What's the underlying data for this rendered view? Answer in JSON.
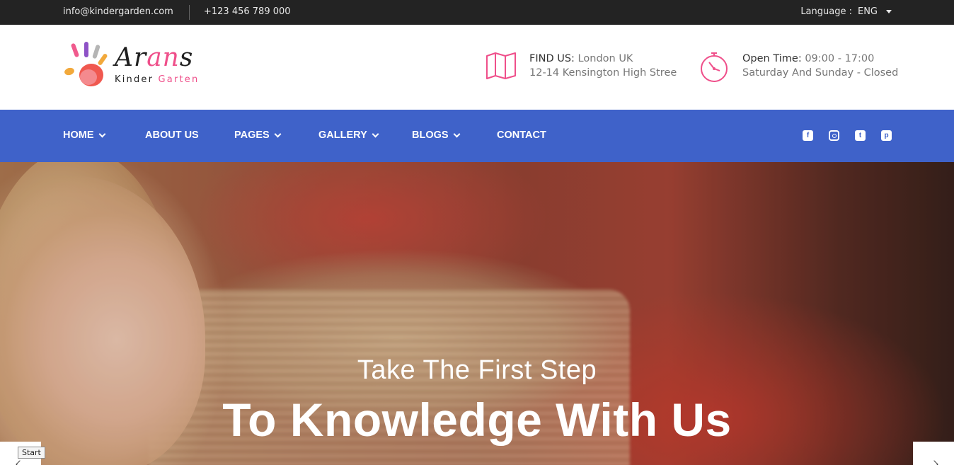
{
  "topbar": {
    "email": "info@kindergarden.com",
    "phone": "+123 456 789 000",
    "language_label": "Language :",
    "language_value": "ENG"
  },
  "logo": {
    "brand_part1": "Ar",
    "brand_part2": "an",
    "brand_part3": "s",
    "sub_part1": "Kinder",
    "sub_part2": "Garten"
  },
  "contact": {
    "find_label": "FIND US:",
    "find_value": " London UK",
    "address": "12-14 Kensington High Stree",
    "time_label": "Open Time:",
    "time_value": " 09:00 - 17:00",
    "closed": "Saturday And Sunday - Closed"
  },
  "nav": {
    "home": "HOME",
    "about": "ABOUT US",
    "pages": "PAGES",
    "gallery": "GALLERY",
    "blogs": "BLOGS",
    "contact": "CONTACT"
  },
  "social": [
    "facebook-icon",
    "instagram-icon",
    "twitter-icon",
    "pinterest-icon"
  ],
  "hero": {
    "pretitle": "Take The First Step",
    "title": "To Knowledge With Us"
  },
  "tooltip": "Start",
  "colors": {
    "topbar": "#232323",
    "nav": "#3f62c9",
    "accent_pink": "#ef4f8a"
  }
}
